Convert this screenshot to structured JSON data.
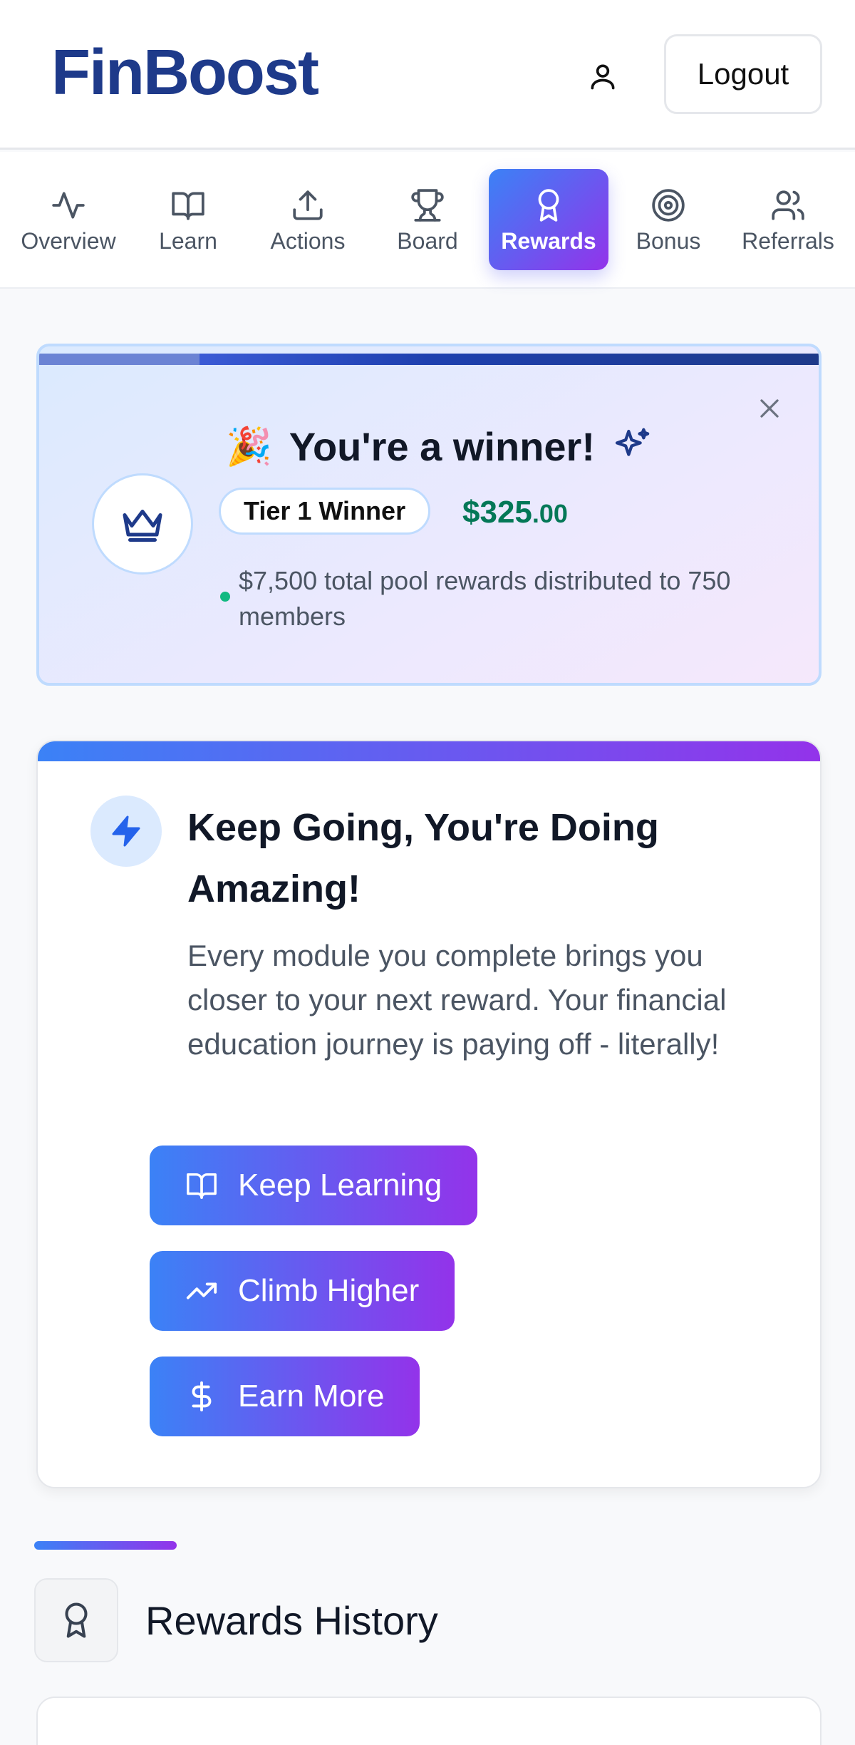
{
  "header": {
    "logo": "FinBoost",
    "logout_label": "Logout",
    "user_icon": "user-icon"
  },
  "tabs": [
    {
      "label": "Overview",
      "icon": "activity-icon"
    },
    {
      "label": "Learn",
      "icon": "book-open-icon"
    },
    {
      "label": "Actions",
      "icon": "upload-icon"
    },
    {
      "label": "Board",
      "icon": "trophy-icon"
    },
    {
      "label": "Rewards",
      "icon": "award-icon",
      "active": true
    },
    {
      "label": "Bonus",
      "icon": "target-icon"
    },
    {
      "label": "Referrals",
      "icon": "users-icon"
    }
  ],
  "winner": {
    "emoji": "🎉",
    "title": "You're a winner!",
    "tier": "Tier 1 Winner",
    "amount_main": "$325",
    "amount_cents": ".00",
    "pool_text": "$7,500 total pool rewards distributed to 750 members"
  },
  "motivation": {
    "title": "Keep Going, You're Doing Amazing!",
    "body": "Every module you complete brings you closer to your next reward. Your financial education journey is paying off - literally!",
    "buttons": [
      {
        "label": "Keep Learning",
        "icon": "book-open-icon"
      },
      {
        "label": "Climb Higher",
        "icon": "trending-up-icon"
      },
      {
        "label": "Earn More",
        "icon": "dollar-sign-icon"
      }
    ]
  },
  "history": {
    "title": "Rewards History"
  },
  "colors": {
    "accent_start": "#3b82f6",
    "accent_end": "#9333ea",
    "brand": "#1e3a8a",
    "amount": "#047857"
  }
}
